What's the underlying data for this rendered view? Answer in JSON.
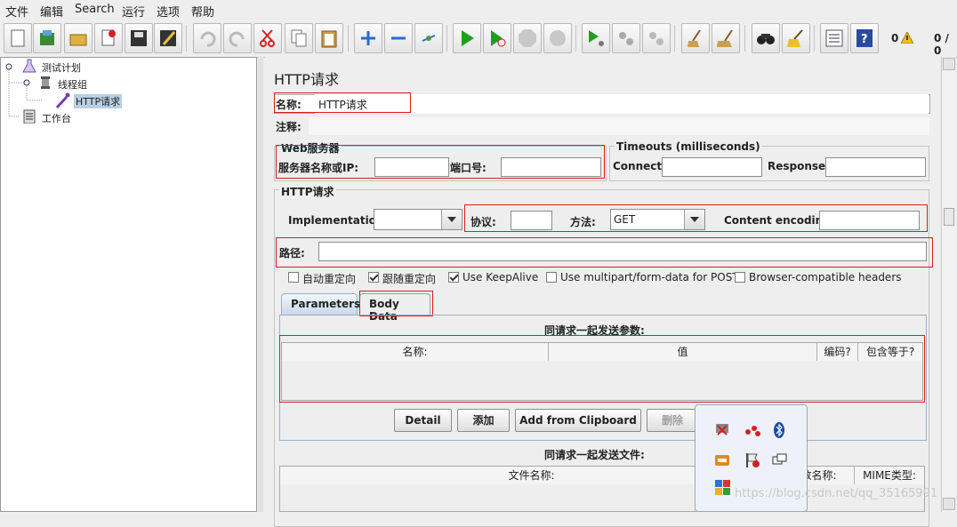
{
  "menu": [
    "文件",
    "编辑",
    "Search",
    "运行",
    "选项",
    "帮助"
  ],
  "toolbar": {
    "warning_count": "0",
    "thread_count": "0 / 0",
    "icons": [
      "new-icon",
      "templates-icon",
      "open-icon",
      "close-icon",
      "save-icon",
      "save-as-icon",
      "undo-icon",
      "redo-icon",
      "cut-icon",
      "copy-icon",
      "paste-icon",
      "expand-icon",
      "collapse-icon",
      "toggle-icon",
      "start-icon",
      "start-no-timers-icon",
      "stop-icon",
      "shutdown-icon",
      "remote-start-icon",
      "remote-stop-icon",
      "remote-shutdown-icon",
      "clear-icon",
      "clear-all-icon",
      "search-icon",
      "reset-search-icon",
      "function-helper-icon",
      "help-icon"
    ]
  },
  "tree": {
    "items": [
      {
        "label": "测试计划",
        "icon": "flask-icon"
      },
      {
        "label": "线程组",
        "icon": "spool-icon"
      },
      {
        "label": "HTTP请求",
        "icon": "pipette-icon",
        "selected": true
      },
      {
        "label": "工作台",
        "icon": "clipboard-icon"
      }
    ]
  },
  "form": {
    "title": "HTTP请求",
    "name_label": "名称:",
    "name_value": "HTTP请求",
    "comment_label": "注释:",
    "web_server": {
      "title": "Web服务器",
      "server_label": "服务器名称或IP:",
      "port_label": "端口号:"
    },
    "timeouts": {
      "title": "Timeouts (milliseconds)",
      "connect_label": "Connect:",
      "response_label": "Response:"
    },
    "http_request": {
      "title": "HTTP请求",
      "implementation_label": "Implementation:",
      "protocol_label": "协议:",
      "method_label": "方法:",
      "method_value": "GET",
      "encoding_label": "Content encoding:",
      "path_label": "路径:"
    },
    "checkboxes": [
      {
        "label": "自动重定向",
        "checked": false
      },
      {
        "label": "跟随重定向",
        "checked": true
      },
      {
        "label": "Use KeepAlive",
        "checked": true
      },
      {
        "label": "Use multipart/form-data for POST",
        "checked": false
      },
      {
        "label": "Browser-compatible headers",
        "checked": false
      }
    ],
    "tabs": [
      "Parameters",
      "Body Data"
    ],
    "params": {
      "title": "同请求一起发送参数:",
      "columns": [
        "名称:",
        "值",
        "编码?",
        "包含等于?"
      ]
    },
    "buttons": {
      "detail": "Detail",
      "add": "添加",
      "add_clipboard": "Add from Clipboard",
      "delete": "删除"
    },
    "files": {
      "title": "同请求一起发送文件:",
      "columns": [
        "文件名称:",
        "数名称:",
        "MIME类型:"
      ]
    }
  },
  "tray_icons": [
    "safely-remove-icon",
    "network-icon",
    "bluetooth-icon",
    "drive-icon",
    "action-center-icon",
    "display-icon",
    "color-squares-icon"
  ],
  "watermark": "https://blog.csdn.net/qq_35165991",
  "colors": {
    "highlight": "#d42020",
    "selection": "#b8cfe5"
  }
}
